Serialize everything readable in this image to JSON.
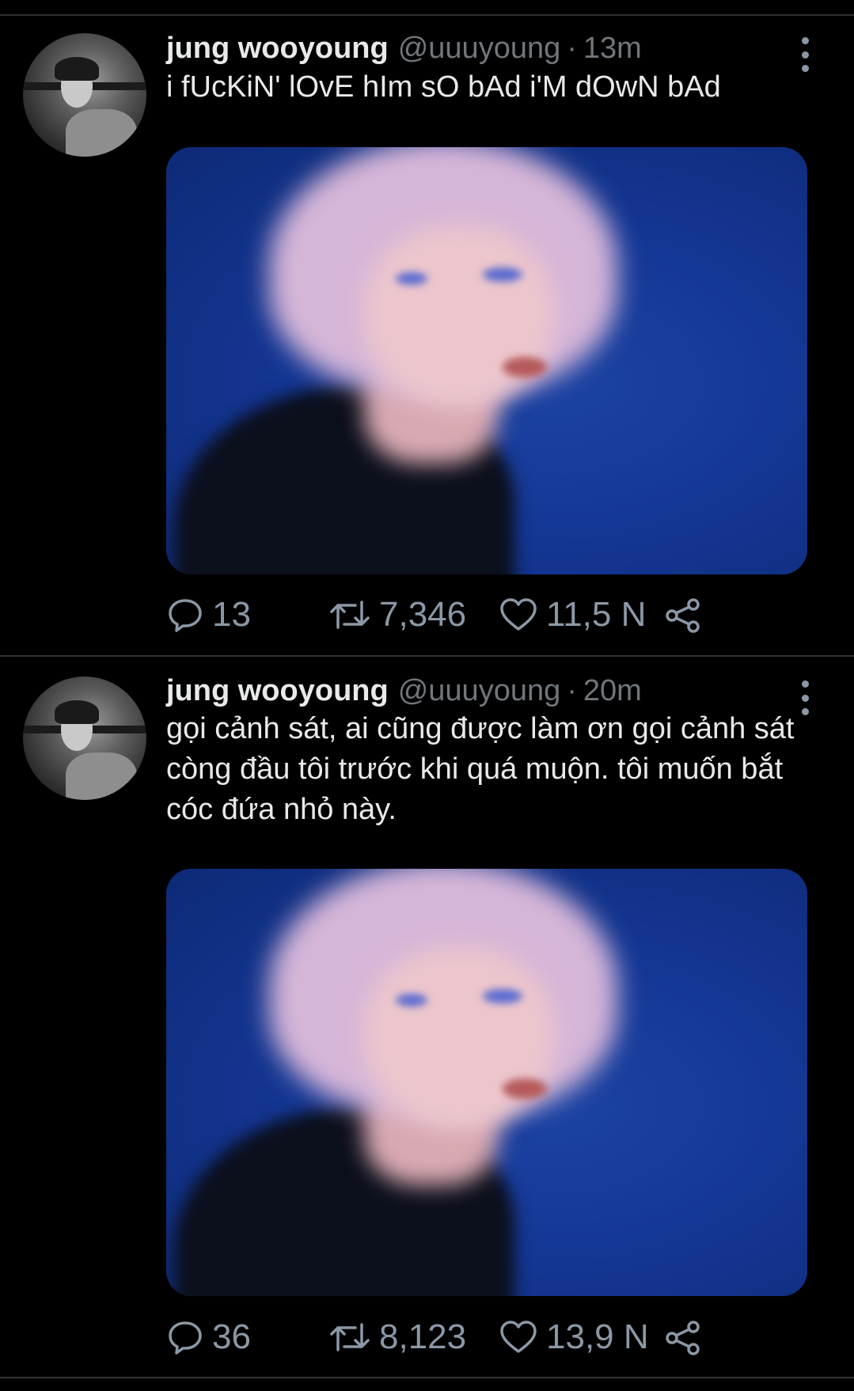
{
  "tweets": [
    {
      "display_name": "jung wooyoung",
      "handle": "@uuuyoung",
      "separator": "·",
      "time": "13m",
      "text": "i fUcKiN' lOvE hIm sO bAd i'M dOwN bAd",
      "stats": {
        "replies": "13",
        "retweets": "7,346",
        "likes": "11,5 N"
      }
    },
    {
      "display_name": "jung wooyoung",
      "handle": "@uuuyoung",
      "separator": "·",
      "time": "20m",
      "text": "gọi cảnh sát, ai cũng được làm ơn gọi cảnh sát còng đầu tôi trước khi quá muộn. tôi muốn bắt cóc đứa nhỏ này.",
      "stats": {
        "replies": "36",
        "retweets": "8,123",
        "likes": "13,9 N"
      }
    }
  ],
  "colors": {
    "background": "#000000",
    "divider": "#2f3336",
    "primary_text": "#e7e9ea",
    "secondary_text": "#71767b",
    "icon": "#8b98a5",
    "media_blue": "#13358a"
  },
  "icons": {
    "reply": "reply-icon",
    "retweet": "retweet-icon",
    "like": "heart-icon",
    "share": "share-icon",
    "more": "more-vertical-icon"
  }
}
